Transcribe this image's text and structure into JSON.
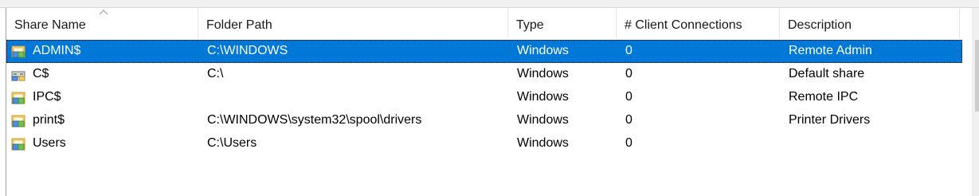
{
  "columns": {
    "share_name": "Share Name",
    "folder_path": "Folder Path",
    "type": "Type",
    "client_connections": "# Client Connections",
    "description": "Description"
  },
  "rows": [
    {
      "share_name": "ADMIN$",
      "folder_path": "C:\\WINDOWS",
      "type": "Windows",
      "client_connections": "0",
      "description": "Remote Admin",
      "icon": "shared-folder-icon",
      "selected": true
    },
    {
      "share_name": "C$",
      "folder_path": "C:\\",
      "type": "Windows",
      "client_connections": "0",
      "description": "Default share",
      "icon": "shared-drive-icon",
      "selected": false
    },
    {
      "share_name": "IPC$",
      "folder_path": "",
      "type": "Windows",
      "client_connections": "0",
      "description": "Remote IPC",
      "icon": "shared-folder-icon",
      "selected": false
    },
    {
      "share_name": "print$",
      "folder_path": "C:\\WINDOWS\\system32\\spool\\drivers",
      "type": "Windows",
      "client_connections": "0",
      "description": "Printer Drivers",
      "icon": "shared-folder-icon",
      "selected": false
    },
    {
      "share_name": "Users",
      "folder_path": "C:\\Users",
      "type": "Windows",
      "client_connections": "0",
      "description": "",
      "icon": "shared-folder-icon",
      "selected": false
    }
  ],
  "colors": {
    "selection": "#0078d7",
    "selection_text": "#ffffff",
    "header_divider": "#e5e5e5"
  }
}
